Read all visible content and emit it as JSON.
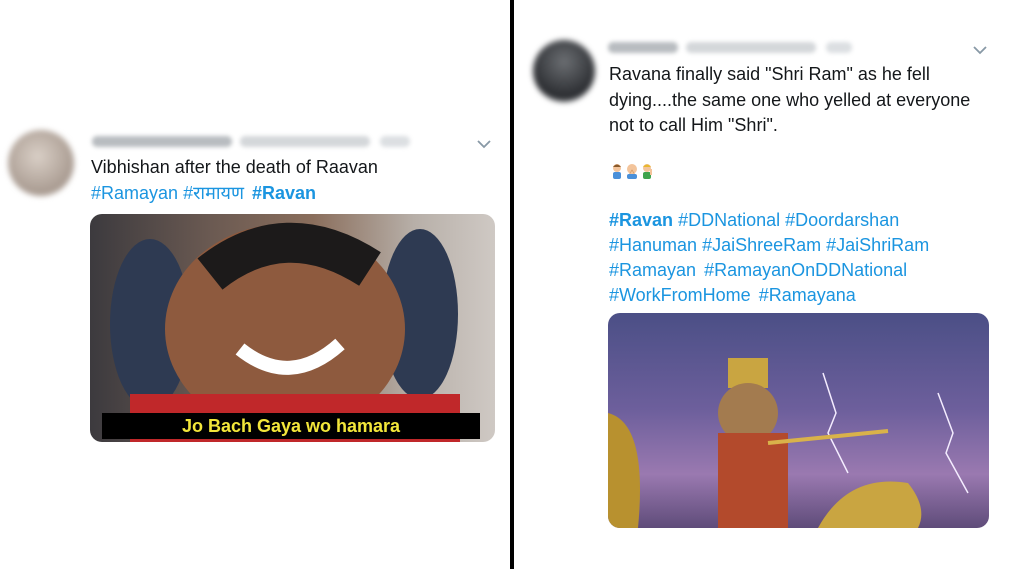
{
  "left_tweet": {
    "text": "Vibhishan after the death of Raavan",
    "hashtags": [
      {
        "text": "#Ramayan",
        "bold": false
      },
      {
        "text": "#रामायण",
        "bold": false
      },
      {
        "text": "#Ravan",
        "bold": true
      }
    ],
    "image_caption": "Jo Bach Gaya wo hamara",
    "menu_icon": "chevron-down-icon"
  },
  "right_tweet": {
    "text_lines": [
      "Ravana finally said \"Shri Ram\" as he fell",
      "dying....the same one who yelled at everyone",
      "not to call Him \"Shri\"."
    ],
    "emojis": [
      "person-bowing-emoji",
      "folded-hands-emoji",
      "person-gesturing-emoji"
    ],
    "hashtag_lines": [
      [
        {
          "text": "#Ravan",
          "bold": true
        },
        {
          "text": "#DDNational",
          "bold": false
        },
        {
          "text": "#Doordarshan",
          "bold": false
        }
      ],
      [
        {
          "text": "#Hanuman",
          "bold": false
        },
        {
          "text": "#JaiShreeRam",
          "bold": false
        },
        {
          "text": "#JaiShriRam",
          "bold": false
        }
      ],
      [
        {
          "text": "#Ramayan",
          "bold": false
        },
        {
          "text": "#RamayanOnDDNational",
          "bold": false
        }
      ],
      [
        {
          "text": "#WorkFromHome",
          "bold": false
        },
        {
          "text": "#Ramayana",
          "bold": false
        }
      ]
    ],
    "menu_icon": "chevron-down-icon"
  },
  "colors": {
    "hashtag": "#1b95e0",
    "text": "#14171a",
    "caption_text": "#f2e63a",
    "divider": "#000000"
  }
}
